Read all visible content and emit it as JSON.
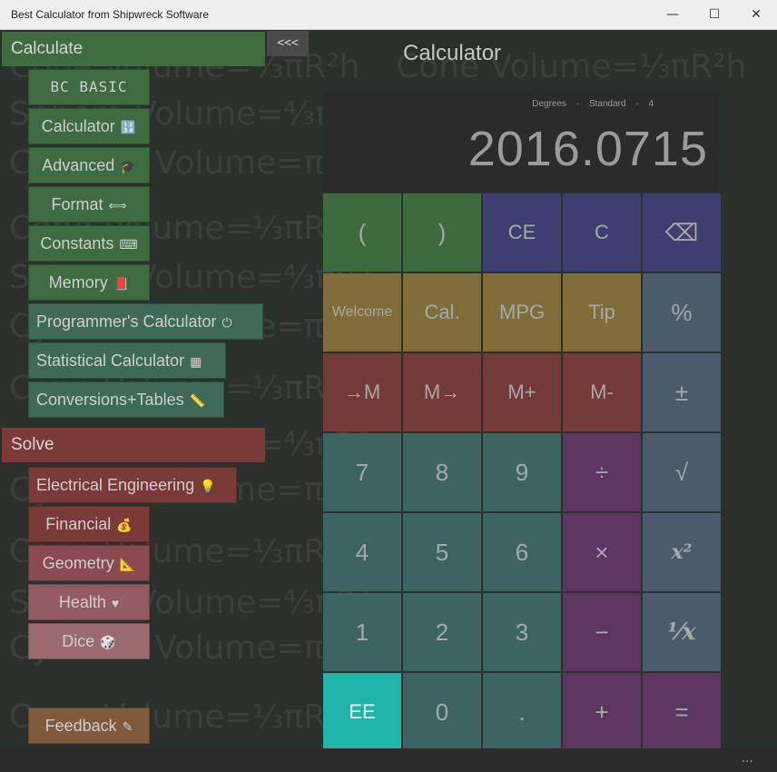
{
  "window": {
    "title": "Best Calculator from Shipwreck Software",
    "minimize": "—",
    "maximize": "☐",
    "close": "✕"
  },
  "sidebar": {
    "collapse_label": "<<<",
    "calculate_header": "Calculate",
    "solve_header": "Solve",
    "calculate_items": [
      {
        "label": "BC BASIC",
        "icon": ""
      },
      {
        "label": "Calculator",
        "icon": "🔢"
      },
      {
        "label": "Advanced",
        "icon": "🎓"
      },
      {
        "label": "Format",
        "icon": "⟺"
      },
      {
        "label": "Constants",
        "icon": "⌨"
      },
      {
        "label": "Memory",
        "icon": "📕"
      },
      {
        "label": "Programmer's Calculator",
        "icon": "⏻"
      },
      {
        "label": "Statistical Calculator",
        "icon": "▦"
      },
      {
        "label": "Conversions+Tables",
        "icon": "📏"
      }
    ],
    "solve_items": [
      {
        "label": "Electrical Engineering",
        "icon": "💡"
      },
      {
        "label": "Financial",
        "icon": "💰"
      },
      {
        "label": "Geometry",
        "icon": "📐"
      },
      {
        "label": "Health",
        "icon": "♥"
      },
      {
        "label": "Dice",
        "icon": "🎲"
      }
    ],
    "feedback": {
      "label": "Feedback",
      "icon": "✎"
    }
  },
  "background_formulas": {
    "cone": "Cone Volume=⅓πR²h",
    "sphere": "Sphere Volume=⁴⁄₃πR³",
    "cylinder": "Cylinder Volume=πR²h"
  },
  "calculator": {
    "title": "Calculator",
    "mode": {
      "angle": "Degrees",
      "separator": "·",
      "format": "Standard",
      "digits": "4"
    },
    "display_value": "2016.0715",
    "keys": [
      [
        "(",
        ")",
        "CE",
        "C",
        "⌫"
      ],
      [
        "Welcome",
        "Cal.",
        "MPG",
        "Tip",
        "%"
      ],
      [
        "→M",
        "M→",
        "M+",
        "M-",
        "±"
      ],
      [
        "7",
        "8",
        "9",
        "÷",
        "√"
      ],
      [
        "4",
        "5",
        "6",
        "×",
        "x²"
      ],
      [
        "1",
        "2",
        "3",
        "−",
        "¹⁄x"
      ],
      [
        "EE",
        "0",
        ".",
        "+",
        "="
      ]
    ]
  },
  "bottom_bar": {
    "more": "..."
  },
  "colors": {
    "calculate_green": "#3e6c3e",
    "solve_red": "#7a3a38",
    "ee_cyan": "#1fb5a8",
    "background": "#2a302c"
  }
}
